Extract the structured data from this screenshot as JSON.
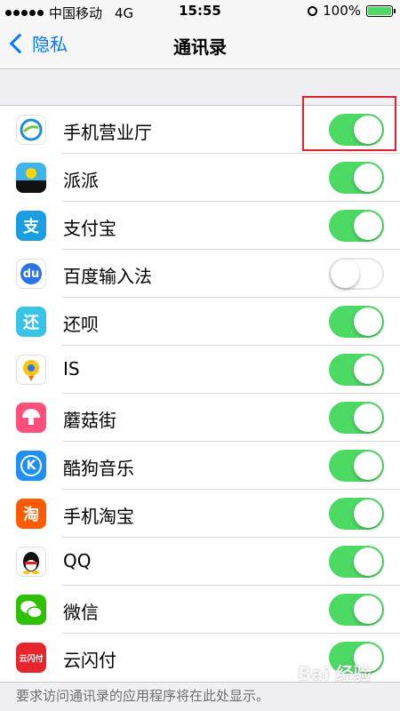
{
  "status_bar": {
    "carrier": "中国移动",
    "network": "4G",
    "time": "15:55",
    "battery": "100%",
    "icons": [
      "signal-dots-icon",
      "alarm-icon",
      "battery-icon"
    ]
  },
  "nav": {
    "back_label": "隐私",
    "title": "通讯录"
  },
  "colors": {
    "toggle_on": "#4cd964",
    "accent": "#007aff",
    "highlight": "#e0222a"
  },
  "apps": [
    {
      "name": "手机营业厅",
      "icon": "china-mobile-icon",
      "enabled": true
    },
    {
      "name": "派派",
      "icon": "paipai-icon",
      "enabled": true
    },
    {
      "name": "支付宝",
      "icon": "alipay-icon",
      "enabled": true
    },
    {
      "name": "百度输入法",
      "icon": "baidu-ime-icon",
      "enabled": false
    },
    {
      "name": "还呗",
      "icon": "huanbei-icon",
      "enabled": true
    },
    {
      "name": "IS",
      "icon": "is-app-icon",
      "enabled": true
    },
    {
      "name": "蘑菇街",
      "icon": "mogujie-icon",
      "enabled": true
    },
    {
      "name": "酷狗音乐",
      "icon": "kugou-icon",
      "enabled": true
    },
    {
      "name": "手机淘宝",
      "icon": "taobao-icon",
      "enabled": true
    },
    {
      "name": "QQ",
      "icon": "qq-icon",
      "enabled": true
    },
    {
      "name": "微信",
      "icon": "wechat-icon",
      "enabled": true
    },
    {
      "name": "云闪付",
      "icon": "unionpay-icon",
      "enabled": true
    }
  ],
  "icon_glyphs": {
    "alipay": "支",
    "baidu": "du",
    "huanbei": "还",
    "kugou": "K",
    "taobao": "淘",
    "unionpay": "云闪付"
  },
  "footer": "要求访问通讯录的应用程序将在此处显示。",
  "watermark": "Bai 经验"
}
